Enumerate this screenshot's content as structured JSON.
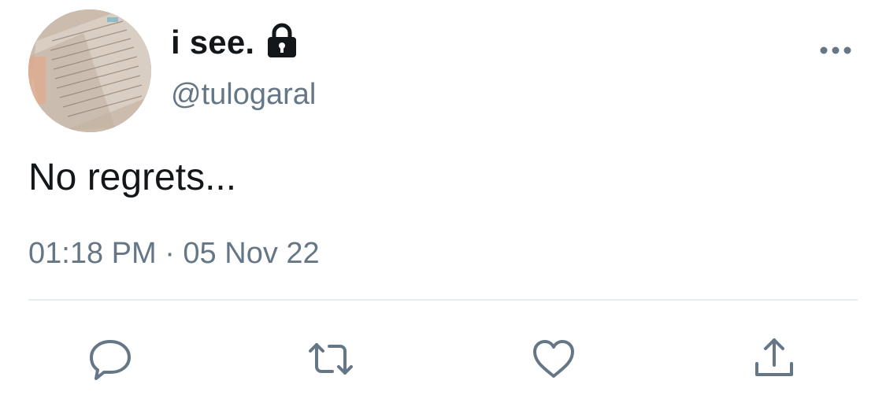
{
  "author": {
    "display_name": "i see.",
    "handle": "@tulogaral",
    "protected": true,
    "avatar_icon": "avatar-photo-notes"
  },
  "tweet": {
    "text": "No regrets...",
    "timestamp": "01:18 PM · 05 Nov 22"
  },
  "actions": {
    "more_icon": "more-dots-icon",
    "reply_icon": "reply-icon",
    "retweet_icon": "retweet-icon",
    "like_icon": "heart-icon",
    "share_icon": "share-icon"
  },
  "colors": {
    "text_primary": "#14171a",
    "text_secondary": "#657786",
    "divider": "#e6ecf0",
    "icon": "#657786"
  }
}
